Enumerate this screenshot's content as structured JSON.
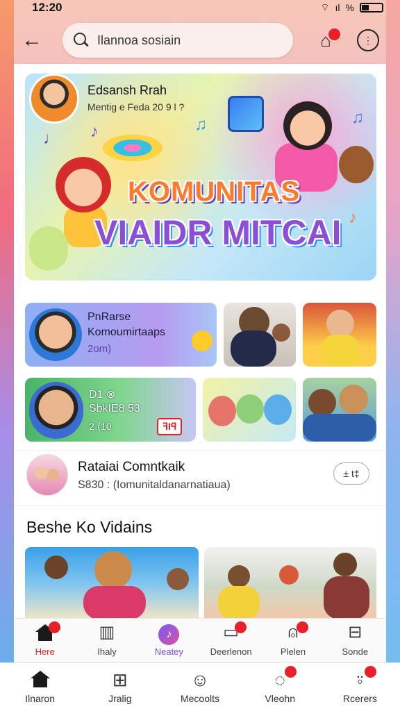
{
  "status": {
    "time": "12:20",
    "icons": "▾ ıl ✕"
  },
  "search": {
    "query": "Ilannoa sosiain"
  },
  "header": {
    "notification_count": ""
  },
  "hero": {
    "name": "Edsansh Rrah",
    "subtitle": "Mentig e Feda 20 9 l ?",
    "title_line1": "KOMUNITAS",
    "title_line2": "VIAIDR MITCAI"
  },
  "cards": {
    "card_a": {
      "line1": "PnRarse",
      "line2": "Komoumirtaaps",
      "line3": "2om)"
    },
    "card_d": {
      "line1": "D1 ⊗",
      "line2": "SbkIE8 53",
      "line3": "2 ⟨10",
      "tag": "ꟻIꟼ"
    }
  },
  "community": {
    "title": "Rataiai Comntkaik",
    "subtitle": "S830 : (Iomunitaldanarnatiaua)",
    "action": "± t‡"
  },
  "section": {
    "title": "Beshe Ko Vidains"
  },
  "inner_nav": [
    {
      "label": "Here",
      "icon": "home-icon",
      "badge": ""
    },
    {
      "label": "Ihaly",
      "icon": "book-icon",
      "badge": ""
    },
    {
      "label": "Neatey",
      "icon": "music-icon",
      "badge": ""
    },
    {
      "label": "Deerlenon",
      "icon": "chat-icon",
      "badge": ""
    },
    {
      "label": "Plelen",
      "icon": "bell-icon",
      "badge": ""
    },
    {
      "label": "Sonde",
      "icon": "settings-icon",
      "badge": ""
    }
  ],
  "outer_nav": [
    {
      "label": "Ilnaron",
      "icon": "home-icon"
    },
    {
      "label": "Jralig",
      "icon": "grid-icon"
    },
    {
      "label": "Mecoolts",
      "icon": "smile-icon"
    },
    {
      "label": "Vleohn",
      "icon": "chat-icon",
      "badge": ""
    },
    {
      "label": "Rcerers",
      "icon": "person-icon",
      "badge": ""
    }
  ],
  "colors": {
    "accent_red": "#e8202a",
    "accent_purple": "#7a4fd6"
  }
}
